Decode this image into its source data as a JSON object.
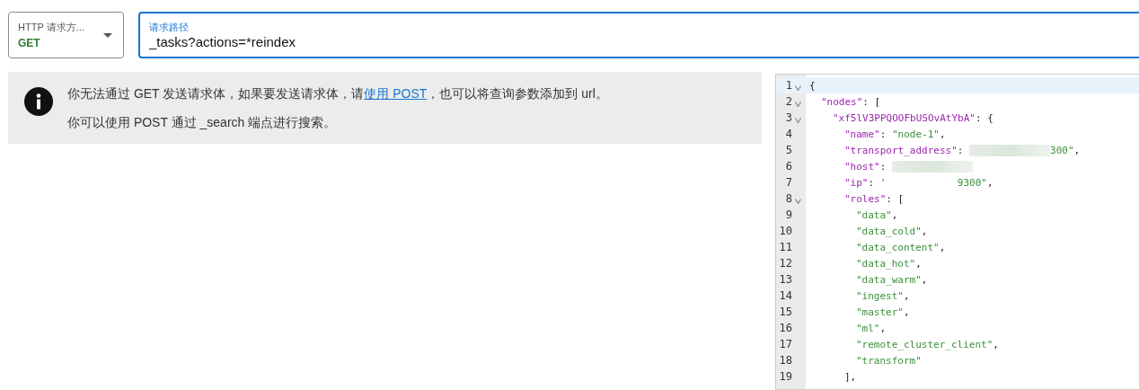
{
  "method_select": {
    "label": "HTTP 请求方...",
    "value": "GET"
  },
  "path_field": {
    "label": "请求路径",
    "value": "_tasks?actions=*reindex",
    "focused": true
  },
  "notice": {
    "lines": [
      {
        "parts": [
          {
            "kind": "text",
            "text": "你无法通过 GET 发送请求体，如果要发送请求体，请"
          },
          {
            "kind": "link",
            "text": "使用 POST"
          },
          {
            "kind": "text",
            "text": "，也可以将查询参数添加到 url。"
          }
        ]
      },
      {
        "parts": [
          {
            "kind": "text",
            "text": "你可以使用 POST 通过 _search 端点进行搜索。"
          }
        ]
      }
    ]
  },
  "editor": {
    "lines": [
      {
        "number": "1",
        "foldable": true,
        "active": true,
        "tokens": [
          {
            "kind": "punct",
            "text": "{"
          }
        ],
        "children": [
          {
            "number": "2",
            "foldable": true,
            "active": false,
            "tokens": [
              {
                "kind": "key",
                "text": "\"nodes\""
              },
              {
                "kind": "punct",
                "text": ": ["
              }
            ],
            "children": [
              {
                "number": "3",
                "foldable": true,
                "active": false,
                "tokens": [
                  {
                    "kind": "key",
                    "text": "\"xf5lV3PPQOOFbUSOvAtYbA\""
                  },
                  {
                    "kind": "punct",
                    "text": ": {"
                  }
                ],
                "children": [
                  {
                    "number": "4",
                    "foldable": false,
                    "active": false,
                    "tokens": [
                      {
                        "kind": "key",
                        "text": "\"name\""
                      },
                      {
                        "kind": "punct",
                        "text": ": "
                      },
                      {
                        "kind": "string",
                        "text": "\"node-1\""
                      },
                      {
                        "kind": "punct",
                        "text": ","
                      }
                    ]
                  },
                  {
                    "number": "5",
                    "foldable": false,
                    "active": false,
                    "tokens": [
                      {
                        "kind": "key",
                        "text": "\"transport_address\""
                      },
                      {
                        "kind": "punct",
                        "text": ": "
                      },
                      {
                        "kind": "redacted"
                      },
                      {
                        "kind": "string",
                        "text": "300\""
                      },
                      {
                        "kind": "punct",
                        "text": ","
                      }
                    ]
                  },
                  {
                    "number": "6",
                    "foldable": false,
                    "active": false,
                    "tokens": [
                      {
                        "kind": "key",
                        "text": "\"host\""
                      },
                      {
                        "kind": "punct",
                        "text": ": "
                      },
                      {
                        "kind": "redacted"
                      }
                    ]
                  },
                  {
                    "number": "7",
                    "foldable": false,
                    "active": false,
                    "tokens": [
                      {
                        "kind": "key",
                        "text": "\"ip\""
                      },
                      {
                        "kind": "punct",
                        "text": ": "
                      },
                      {
                        "kind": "string",
                        "text": "'            9300\""
                      },
                      {
                        "kind": "punct",
                        "text": ","
                      }
                    ]
                  },
                  {
                    "number": "8",
                    "foldable": true,
                    "active": false,
                    "tokens": [
                      {
                        "kind": "key",
                        "text": "\"roles\""
                      },
                      {
                        "kind": "punct",
                        "text": ": ["
                      }
                    ],
                    "children": [
                      {
                        "number": "9",
                        "foldable": false,
                        "active": false,
                        "tokens": [
                          {
                            "kind": "string",
                            "text": "\"data\""
                          },
                          {
                            "kind": "punct",
                            "text": ","
                          }
                        ]
                      },
                      {
                        "number": "10",
                        "foldable": false,
                        "active": false,
                        "tokens": [
                          {
                            "kind": "string",
                            "text": "\"data_cold\""
                          },
                          {
                            "kind": "punct",
                            "text": ","
                          }
                        ]
                      },
                      {
                        "number": "11",
                        "foldable": false,
                        "active": false,
                        "tokens": [
                          {
                            "kind": "string",
                            "text": "\"data_content\""
                          },
                          {
                            "kind": "punct",
                            "text": ","
                          }
                        ]
                      },
                      {
                        "number": "12",
                        "foldable": false,
                        "active": false,
                        "tokens": [
                          {
                            "kind": "string",
                            "text": "\"data_hot\""
                          },
                          {
                            "kind": "punct",
                            "text": ","
                          }
                        ]
                      },
                      {
                        "number": "13",
                        "foldable": false,
                        "active": false,
                        "tokens": [
                          {
                            "kind": "string",
                            "text": "\"data_warm\""
                          },
                          {
                            "kind": "punct",
                            "text": ","
                          }
                        ]
                      },
                      {
                        "number": "14",
                        "foldable": false,
                        "active": false,
                        "tokens": [
                          {
                            "kind": "string",
                            "text": "\"ingest\""
                          },
                          {
                            "kind": "punct",
                            "text": ","
                          }
                        ]
                      },
                      {
                        "number": "15",
                        "foldable": false,
                        "active": false,
                        "tokens": [
                          {
                            "kind": "string",
                            "text": "\"master\""
                          },
                          {
                            "kind": "punct",
                            "text": ","
                          }
                        ]
                      },
                      {
                        "number": "16",
                        "foldable": false,
                        "active": false,
                        "tokens": [
                          {
                            "kind": "string",
                            "text": "\"ml\""
                          },
                          {
                            "kind": "punct",
                            "text": ","
                          }
                        ]
                      },
                      {
                        "number": "17",
                        "foldable": false,
                        "active": false,
                        "tokens": [
                          {
                            "kind": "string",
                            "text": "\"remote_cluster_client\""
                          },
                          {
                            "kind": "punct",
                            "text": ","
                          }
                        ]
                      },
                      {
                        "number": "18",
                        "foldable": false,
                        "active": false,
                        "tokens": [
                          {
                            "kind": "string",
                            "text": "\"transform\""
                          }
                        ]
                      }
                    ]
                  },
                  {
                    "number": "19",
                    "foldable": false,
                    "active": false,
                    "tokens": [
                      {
                        "kind": "punct",
                        "text": "],"
                      }
                    ]
                  }
                ]
              }
            ]
          }
        ]
      }
    ]
  }
}
